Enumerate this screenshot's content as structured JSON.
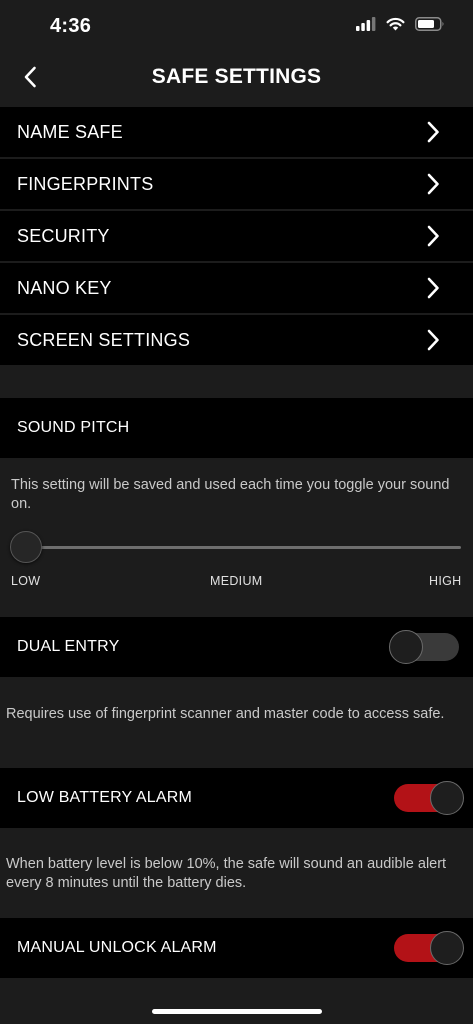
{
  "status_bar": {
    "time": "4:36",
    "icons": [
      "signal-icon",
      "wifi-icon",
      "battery-icon"
    ]
  },
  "header": {
    "title": "SAFE SETTINGS",
    "back_icon": "chevron-left-icon"
  },
  "menu": {
    "items": [
      {
        "label": "NAME SAFE"
      },
      {
        "label": "FINGERPRINTS"
      },
      {
        "label": "SECURITY"
      },
      {
        "label": "NANO KEY"
      },
      {
        "label": "SCREEN SETTINGS"
      }
    ]
  },
  "sound_pitch": {
    "label": "SOUND PITCH",
    "description": "This setting will be saved and used each time you toggle your sound on.",
    "slider": {
      "value": 0,
      "labels": [
        "LOW",
        "MEDIUM",
        "HIGH"
      ]
    }
  },
  "dual_entry": {
    "label": "DUAL ENTRY",
    "enabled": false,
    "description": "Requires use of fingerprint scanner and master code to access safe."
  },
  "low_battery_alarm": {
    "label": "LOW BATTERY ALARM",
    "enabled": true,
    "description": "When battery level is below 10%, the safe will sound an audible alert every 8 minutes until the battery dies."
  },
  "manual_unlock_alarm": {
    "label": "MANUAL UNLOCK ALARM",
    "enabled": true
  },
  "colors": {
    "background": "#1c1c1c",
    "row_background": "#000000",
    "toggle_on": "#b31217",
    "toggle_off": "#3a3a3a",
    "description_text": "#c9c9c9"
  }
}
